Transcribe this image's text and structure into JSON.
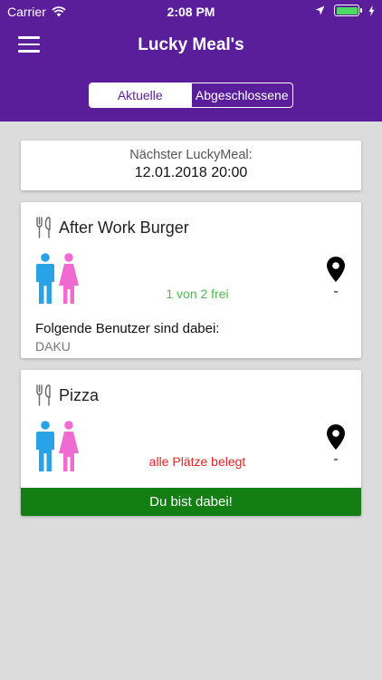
{
  "status_bar": {
    "carrier": "Carrier",
    "time": "2:08 PM"
  },
  "header": {
    "title": "Lucky Meal's",
    "tabs": [
      {
        "label": "Aktuelle",
        "active": true
      },
      {
        "label": "Abgeschlossene",
        "active": false
      }
    ]
  },
  "next_meal": {
    "label": "Nächster LuckyMeal:",
    "date": "12.01.2018 20:00"
  },
  "meals": [
    {
      "title": "After Work Burger",
      "availability": "1 von 2 frei",
      "location": "-",
      "users_label": "Folgende Benutzer sind dabei:",
      "users": "DAKU"
    },
    {
      "title": "Pizza",
      "availability": "alle Plätze belegt",
      "location": "-",
      "join_label": "Du bist dabei!"
    }
  ],
  "colors": {
    "header": "#5a1e9b",
    "male_icon": "#29a3e6",
    "female_icon": "#ef6bd2",
    "available_text": "#4cbb4c",
    "full_text": "#e02424",
    "joined_bar": "#137e13"
  },
  "icons": [
    "wifi-icon",
    "location-arrow-icon",
    "battery-icon",
    "menu-icon",
    "cutlery-icon",
    "male-icon",
    "female-icon",
    "location-pin-icon"
  ]
}
